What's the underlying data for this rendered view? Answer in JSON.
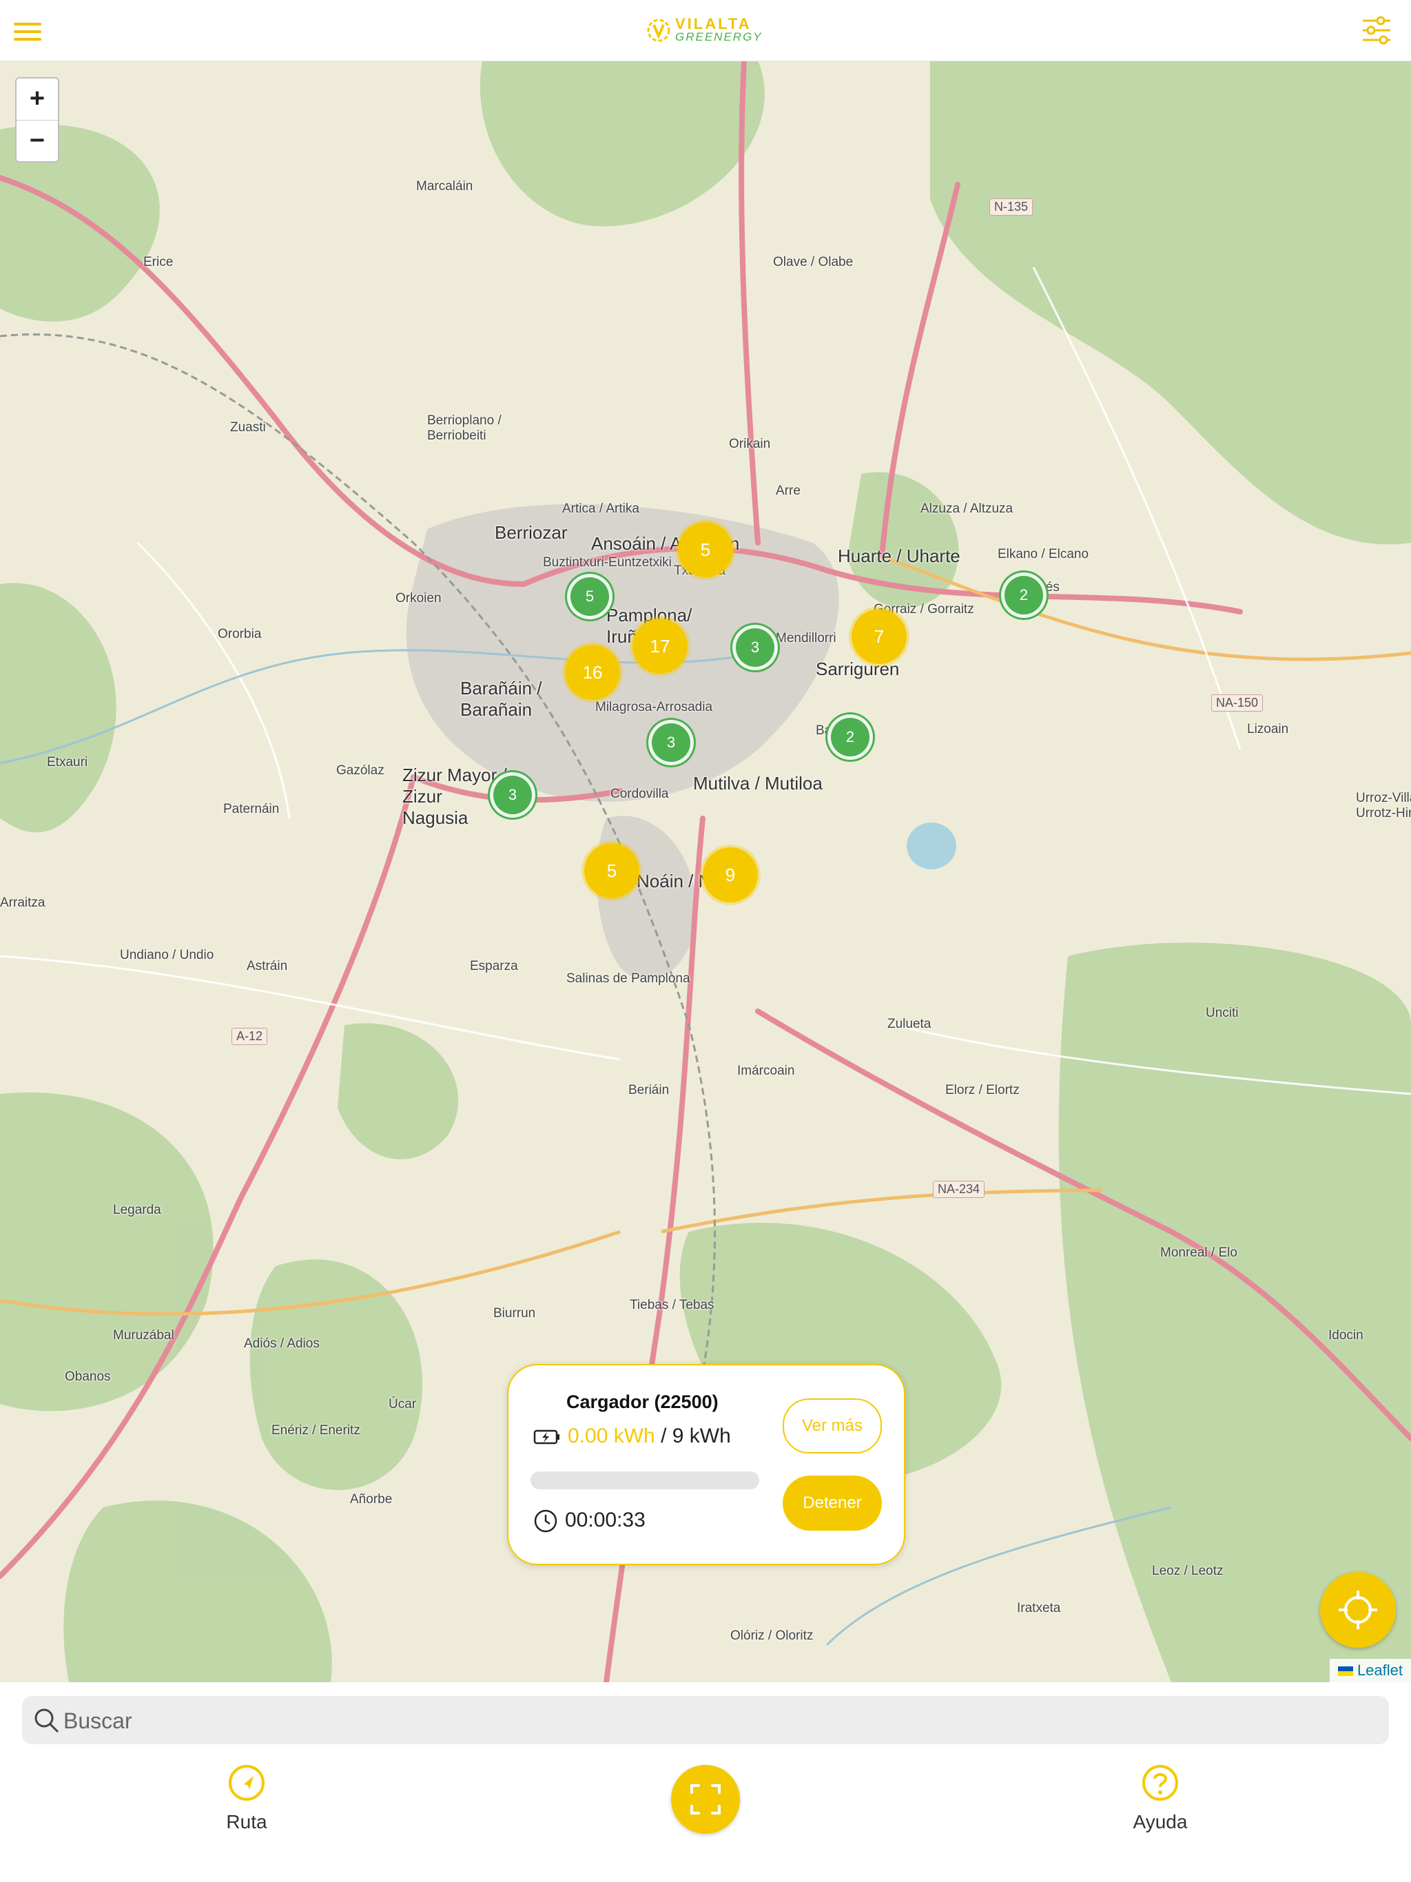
{
  "header": {
    "logo_top": "VILALTA",
    "logo_bottom": "GREENERGY"
  },
  "map": {
    "zoom_in": "+",
    "zoom_out": "−",
    "attribution": "Leaflet",
    "places": [
      {
        "name": "Marcaláin"
      },
      {
        "name": "Erice"
      },
      {
        "name": "Olave / Olabe"
      },
      {
        "name": "Zuasti"
      },
      {
        "name": "Berrioplano / Berriobeiti"
      },
      {
        "name": "Orikain"
      },
      {
        "name": "Arre"
      },
      {
        "name": "Artica / Artika"
      },
      {
        "name": "Berriozar"
      },
      {
        "name": "Ansoáin / Antsoain"
      },
      {
        "name": "Huarte / Uharte"
      },
      {
        "name": "Alzuza / Altzuza"
      },
      {
        "name": "Elkano / Elcano"
      },
      {
        "name": "Egüés"
      },
      {
        "name": "Buztintxuri-Euntzetxiki"
      },
      {
        "name": "Txantrea"
      },
      {
        "name": "Orkoien"
      },
      {
        "name": "Pamplona/ Iruña"
      },
      {
        "name": "Mendillorri"
      },
      {
        "name": "Gorraiz / Gorraitz"
      },
      {
        "name": "Ororbia"
      },
      {
        "name": "Sarriguren"
      },
      {
        "name": "Barañáin / Barañain"
      },
      {
        "name": "Milagrosa-Arrosadia"
      },
      {
        "name": "Badostáin"
      },
      {
        "name": "Lizoain"
      },
      {
        "name": "Etxauri"
      },
      {
        "name": "Gazólaz"
      },
      {
        "name": "Zizur Mayor / Zizur Nagusia"
      },
      {
        "name": "Cordovilla"
      },
      {
        "name": "Mutilva / Mutiloa"
      },
      {
        "name": "Paternáin"
      },
      {
        "name": "Urroz-Villa / Urrotz-Hiria"
      },
      {
        "name": "Arraitza"
      },
      {
        "name": "Noáin / Noain"
      },
      {
        "name": "Undiano / Undio"
      },
      {
        "name": "Astráin"
      },
      {
        "name": "Esparza"
      },
      {
        "name": "Salinas de Pamplona"
      },
      {
        "name": "Zulueta"
      },
      {
        "name": "Unciti"
      },
      {
        "name": "Imárcoain"
      },
      {
        "name": "Beriáin"
      },
      {
        "name": "Elorz / Elortz"
      },
      {
        "name": "Legarda"
      },
      {
        "name": "Monreal / Elo"
      },
      {
        "name": "Tiebas / Tebas"
      },
      {
        "name": "Biurrun"
      },
      {
        "name": "Muruzábal"
      },
      {
        "name": "Adiós / Adios"
      },
      {
        "name": "Obanos"
      },
      {
        "name": "Úcar"
      },
      {
        "name": "Idocin"
      },
      {
        "name": "Enériz / Eneritz"
      },
      {
        "name": "Añorbe"
      },
      {
        "name": "Leoz / Leotz"
      },
      {
        "name": "Iratxeta"
      },
      {
        "name": "Olóriz / Oloritz"
      }
    ],
    "roads": [
      "N-135",
      "NA-150",
      "A-12",
      "NA-234"
    ],
    "clusters": [
      {
        "count": "5",
        "type": "yellow"
      },
      {
        "count": "5",
        "type": "green"
      },
      {
        "count": "17",
        "type": "yellow"
      },
      {
        "count": "16",
        "type": "yellow"
      },
      {
        "count": "3",
        "type": "green"
      },
      {
        "count": "7",
        "type": "yellow"
      },
      {
        "count": "2",
        "type": "green"
      },
      {
        "count": "2",
        "type": "green"
      },
      {
        "count": "3",
        "type": "green"
      },
      {
        "count": "3",
        "type": "green"
      },
      {
        "count": "5",
        "type": "yellow"
      },
      {
        "count": "9",
        "type": "yellow"
      }
    ]
  },
  "card": {
    "title": "Cargador (22500)",
    "energy_current": "0.00 kWh",
    "energy_separator": "/",
    "energy_total": "9 kWh",
    "progress": 0,
    "timer": "00:00:33",
    "more_label": "Ver más",
    "stop_label": "Detener"
  },
  "bottom": {
    "search_placeholder": "Buscar",
    "route_label": "Ruta",
    "help_label": "Ayuda"
  },
  "colors": {
    "accent": "#f5c900",
    "green": "#4caf50"
  }
}
